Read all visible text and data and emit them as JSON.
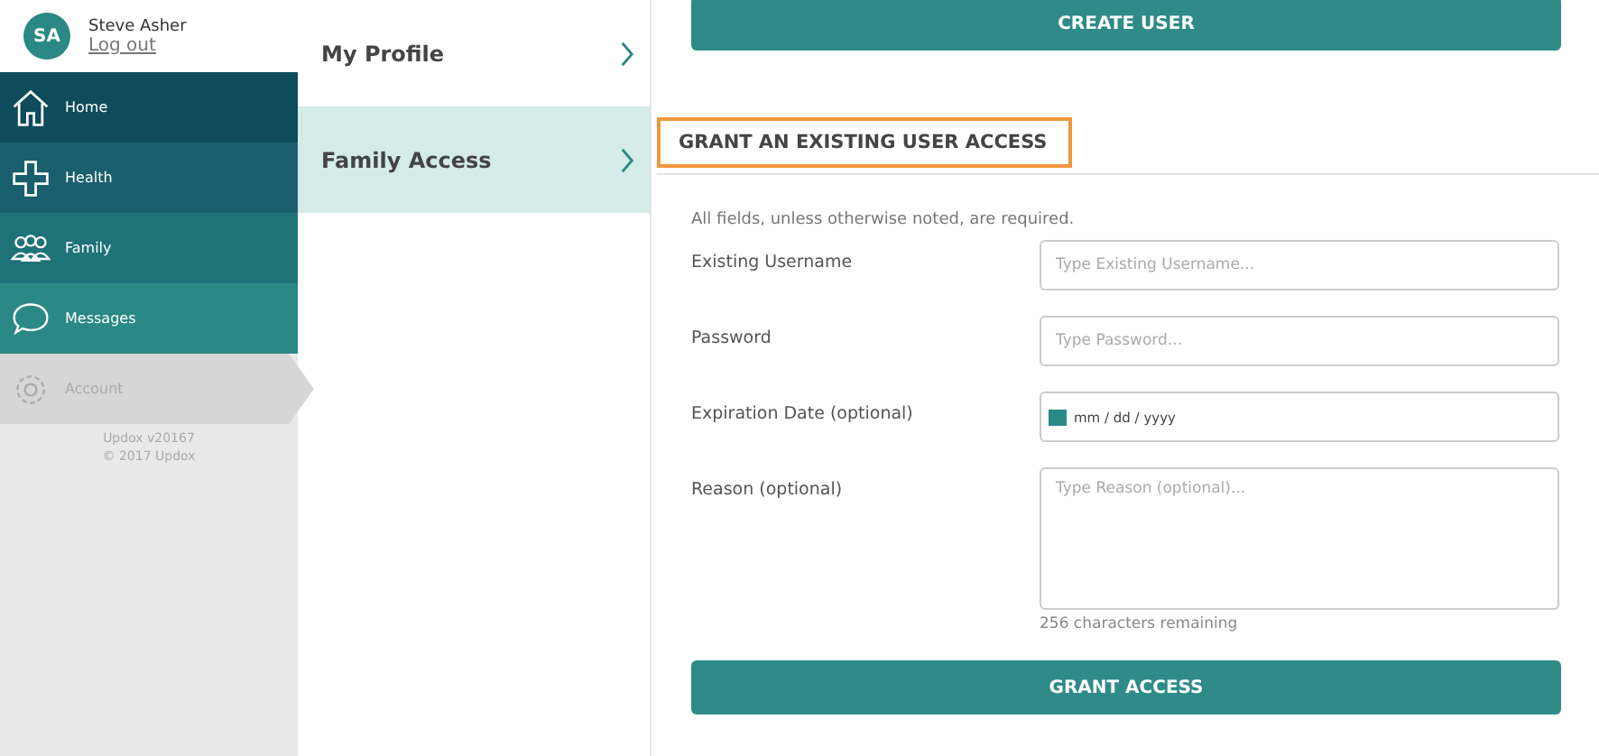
{
  "user": {
    "initials": "SA",
    "name": "Steve Asher",
    "logout": "Log out"
  },
  "nav": [
    {
      "label": "Home",
      "selected": false
    },
    {
      "label": "Health",
      "selected": false
    },
    {
      "label": "Family",
      "selected": false
    },
    {
      "label": "Messages",
      "selected": false
    },
    {
      "label": "Account",
      "selected": true
    }
  ],
  "version": "Updox v20167",
  "copyright": "© 2017 Updox",
  "subnav": [
    {
      "label": "My Profile",
      "selected": false
    },
    {
      "label": "Family Access",
      "selected": true
    }
  ],
  "create_button": "CREATE USER",
  "section_title": "GRANT AN EXISTING USER ACCESS",
  "note": "All fields, unless otherwise noted, are required.",
  "fields": [
    {
      "kind": "text",
      "label": "Existing Username",
      "placeholder": "Type Existing Username..."
    },
    {
      "kind": "text",
      "label": "Password",
      "placeholder": "Type Password..."
    },
    {
      "kind": "date",
      "label": "Expiration Date (optional)",
      "placeholder": "mm / dd / yyyy"
    },
    {
      "kind": "textarea",
      "label": "Reason (optional)",
      "placeholder": "Type Reason (optional)...",
      "helper": "256 characters remaining"
    }
  ],
  "submit_button": "GRANT ACCESS"
}
